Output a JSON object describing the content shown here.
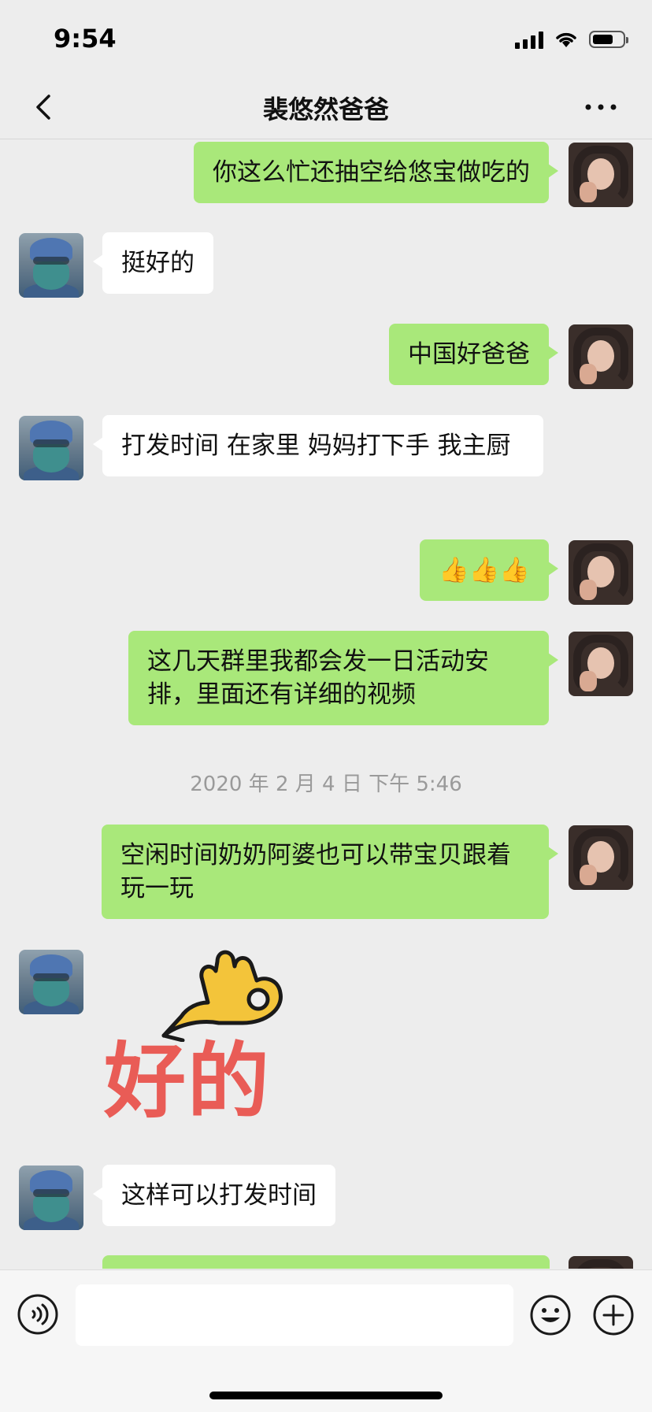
{
  "status_bar": {
    "time": "9:54",
    "battery_level": 0.7
  },
  "header": {
    "title": "裴悠然爸爸"
  },
  "messages": [
    {
      "side": "me",
      "text": "你这么忙还抽空给悠宝做吃的"
    },
    {
      "side": "them",
      "text": "挺好的"
    },
    {
      "side": "me",
      "text": "中国好爸爸"
    },
    {
      "side": "them",
      "text": "打发时间 在家里 妈妈打下手 我主厨"
    },
    {
      "side": "me",
      "text": "👍👍👍"
    },
    {
      "side": "me",
      "text": "这几天群里我都会发一日活动安排，里面还有详细的视频"
    },
    {
      "side": "me",
      "text": "空闲时间奶奶阿婆也可以带宝贝跟着玩一玩"
    },
    {
      "side": "them",
      "sticker": "ok-hand-sticker",
      "text": "好的"
    },
    {
      "side": "them",
      "text": "这样可以打发时间"
    }
  ],
  "timestamp": "2020 年 2 月 4 日  下午 5:46",
  "input_bar": {
    "placeholder": ""
  },
  "colors": {
    "my_bubble": "#a9e87a",
    "their_bubble": "#ffffff",
    "background": "#ededed"
  }
}
